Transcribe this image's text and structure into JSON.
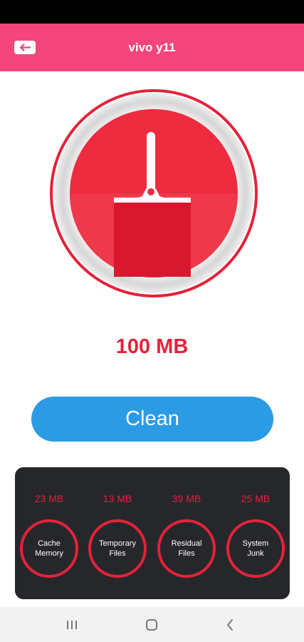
{
  "header": {
    "title": "vivo y11",
    "back_icon": "arrow-left-icon"
  },
  "cleaner": {
    "icon": "broom-icon",
    "total_size": "100 MB",
    "accent": "#e5223a"
  },
  "clean_button": {
    "label": "Clean",
    "color": "#2b9be6"
  },
  "categories": [
    {
      "size": "23 MB",
      "label": "Cache Memory"
    },
    {
      "size": "13 MB",
      "label": "Temporary Files"
    },
    {
      "size": "39 MB",
      "label": "Residual Files"
    },
    {
      "size": "25 MB",
      "label": "System Junk"
    }
  ],
  "nav": {
    "recents_icon": "recents-icon",
    "home_icon": "home-icon",
    "back_icon": "nav-back-icon"
  },
  "colors": {
    "app_bar": "#f5457d",
    "panel": "#26272b"
  }
}
